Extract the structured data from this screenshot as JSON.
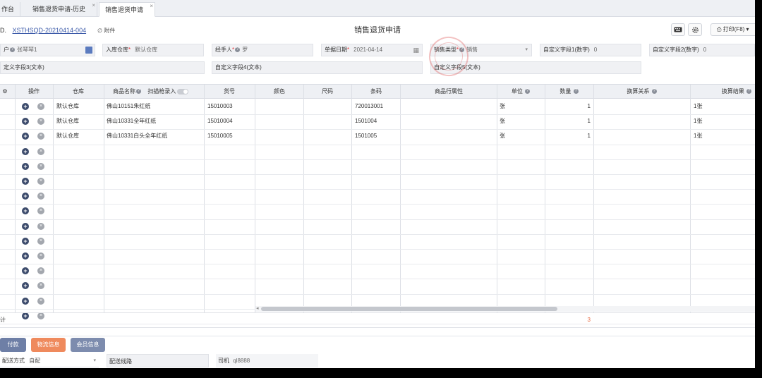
{
  "tabs": [
    {
      "label": "作台"
    },
    {
      "label": "销售退货申请-历史",
      "close": "×"
    },
    {
      "label": "销售退货申请",
      "close": "×"
    }
  ],
  "header": {
    "doc_prefix": "D.",
    "doc_number": "XSTHSQD-20210414-004",
    "attach_label": "附件",
    "title": "销售退货申请",
    "print_label": "打印(F8)"
  },
  "form": {
    "customer": {
      "label": "户",
      "value": "张琴琴1"
    },
    "warehouse": {
      "label": "入库仓库",
      "required": "*",
      "value": "默认仓库"
    },
    "handler": {
      "label": "经手人",
      "required": "*",
      "value": "罗"
    },
    "doc_date": {
      "label": "单据日期",
      "required": "*",
      "value": "2021-04-14"
    },
    "sale_type": {
      "label": "销售类型",
      "required": "*",
      "value": "销售"
    },
    "custom1": {
      "label": "自定义字段1(数字)",
      "value": "0"
    },
    "custom2": {
      "label": "自定义字段2(数字)",
      "value": "0"
    },
    "custom3": {
      "label": "定义字段3(文本)"
    },
    "custom4": {
      "label": "自定义字段4(文本)"
    },
    "custom5": {
      "label": "自定义字段5(文本)"
    }
  },
  "table": {
    "headers": {
      "op": "操作",
      "warehouse": "仓库",
      "product": "商品名称",
      "scan": "扫描枪录入",
      "item_no": "货号",
      "color": "颜色",
      "size": "尺码",
      "barcode": "条码",
      "attr": "商品行属性",
      "unit": "单位",
      "qty": "数量",
      "conv": "换算关系",
      "conv_result": "换算结果"
    },
    "rows": [
      {
        "warehouse": "默认仓库",
        "product": "佛山10151朱红纸",
        "item_no": "15010003",
        "barcode": "720013001",
        "unit": "张",
        "qty": "1",
        "conv_result": "1张"
      },
      {
        "warehouse": "默认仓库",
        "product": "佛山10331全年红纸",
        "item_no": "15010004",
        "barcode": "1501004",
        "unit": "张",
        "qty": "1",
        "conv_result": "1张"
      },
      {
        "warehouse": "默认仓库",
        "product": "佛山10331白头全年红纸",
        "item_no": "15010005",
        "barcode": "1501005",
        "unit": "张",
        "qty": "1",
        "conv_result": "1张"
      }
    ],
    "total_label": "计",
    "total_qty": "3"
  },
  "buttons": {
    "pay": "付款",
    "logistics": "物流信息",
    "member": "会员信息"
  },
  "bottom": {
    "delivery_label": "配送方式",
    "delivery_value": "自配",
    "route_label": "配送线路",
    "driver_label": "司机",
    "driver_value": "ql8888"
  },
  "colors": {
    "link": "#3b5aa9",
    "required": "#e4393c",
    "pay_btn": "#6e7fa6",
    "logistics_btn": "#ef8a5d",
    "member_btn": "#7d8cae",
    "total_qty": "#e8663d"
  }
}
